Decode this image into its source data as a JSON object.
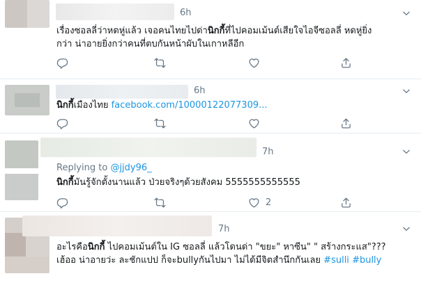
{
  "tweets": [
    {
      "time": "6h",
      "line1_pre": "เรื่องซอลลี่ว่าหดหู่แล้ว เจอคนไทยไปด่า",
      "line1_bold": "นิกกี้",
      "line1_post": "ที่ไปคอมเม้นต์เสียใจไอจีซอลลี่ หดหู่ยิ่ง",
      "line2": "กว่า น่าอายยิ่งกว่าคนที่ตบกันหน้าผับในเกาหลีอีก"
    },
    {
      "time": "6h",
      "bold": "นิกกี้",
      "text": "เมืองไทย ",
      "link": "facebook.com/10000122077309..."
    },
    {
      "time": "7h",
      "replying_label": "Replying to ",
      "replying_handle": "@jjdy96_",
      "bold": "นิกกี้",
      "text": "มันรู้จักตั้งนานแล้ว ป่วยจริงๆด้วยสังคม 5555555555555",
      "like_count": "2"
    },
    {
      "time": "7h",
      "line1_pre": "อะไรคือ",
      "line1_bold": "นิกกี้",
      "line1_post": " ไปคอมเม้นต์ใน IG ซอลลี่ แล้วโดนด่า \"ขยะ\" หาซีน\" \" สร้างกระแส\"???",
      "line2_pre": "เฮ้ออ น่าอายว่ะ ละชักแปป  ก็จะbullyกันไปมา ไม่ได้มีจิตสำนึกกันเลย ",
      "tag1": "#sulli",
      "tag2": "#bully"
    }
  ],
  "icons": [
    "reply-icon",
    "retweet-icon",
    "like-icon",
    "share-icon",
    "chevron-down-icon"
  ],
  "colors": {
    "link": "#1b95e0",
    "muted": "#657786",
    "text": "#14171a",
    "divider": "#e6ecf0"
  }
}
